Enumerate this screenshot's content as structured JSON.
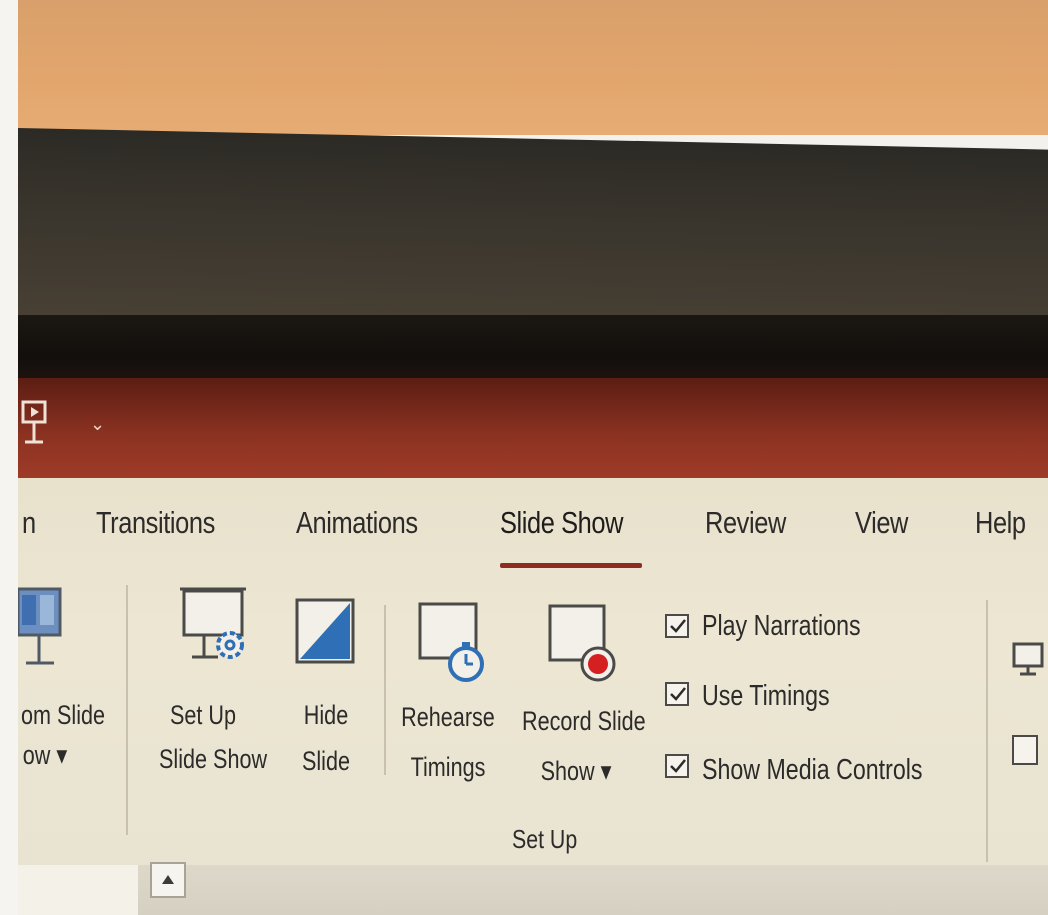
{
  "quick_access": {
    "present_icon": "presentation-icon",
    "more_glyph": "⌄"
  },
  "tabs": [
    {
      "label": "n"
    },
    {
      "label": "Transitions"
    },
    {
      "label": "Animations"
    },
    {
      "label": "Slide Show",
      "active": true
    },
    {
      "label": "Review"
    },
    {
      "label": "View"
    },
    {
      "label": "Help"
    }
  ],
  "buttons": {
    "from_slide": {
      "line1": "om Slide",
      "line2": "ow ▾"
    },
    "set_up_show": {
      "line1": "Set Up",
      "line2": "Slide Show"
    },
    "hide_slide": {
      "line1": "Hide",
      "line2": "Slide"
    },
    "rehearse": {
      "line1": "Rehearse",
      "line2": "Timings"
    },
    "record": {
      "line1": "Record Slide",
      "line2": "Show ▾"
    }
  },
  "checkboxes": [
    {
      "label": "Play Narrations",
      "checked": true
    },
    {
      "label": "Use Timings",
      "checked": true
    },
    {
      "label": "Show Media Controls",
      "checked": true
    }
  ],
  "group_label": "Set Up",
  "colors": {
    "accent": "#8c2d1f",
    "titlebar": "#8c3222",
    "icon_blue": "#2f6fb5",
    "record_red": "#d42020"
  }
}
